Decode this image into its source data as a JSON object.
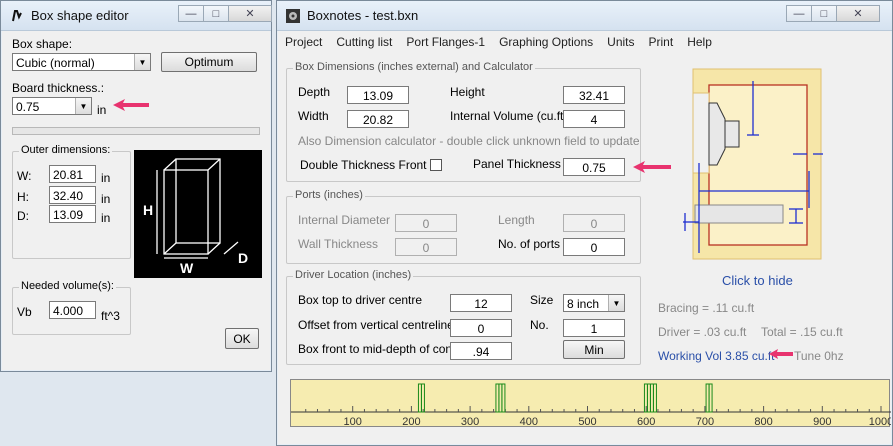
{
  "left_window": {
    "title": "Box shape editor",
    "box_shape_label": "Box shape:",
    "box_shape_value": "Cubic (normal)",
    "optimum_button": "Optimum",
    "board_thickness_label": "Board thickness.:",
    "board_thickness_value": "0.75",
    "board_thickness_unit": "in",
    "outer_dimensions_label": "Outer dimensions:",
    "outer": {
      "w_label": "W:",
      "w_value": "20.81",
      "h_label": "H:",
      "h_value": "32.40",
      "d_label": "D:",
      "d_value": "13.09",
      "unit": "in"
    },
    "diagram": {
      "h": "H",
      "w": "W",
      "d": "D"
    },
    "needed_volume_label": "Needed volume(s):",
    "vb_label": "Vb",
    "vb_value": "4.000",
    "vb_unit": "ft^3",
    "ok_button": "OK"
  },
  "right_window": {
    "title": "Boxnotes - test.bxn",
    "menu": [
      "Project",
      "Cutting list",
      "Port Flanges-1",
      "Graphing Options",
      "Units",
      "Print",
      "Help"
    ],
    "box_dimensions": {
      "group_title": "Box Dimensions (inches external) and Calculator",
      "depth_label": "Depth",
      "depth_value": "13.09",
      "height_label": "Height",
      "height_value": "32.41",
      "width_label": "Width",
      "width_value": "20.82",
      "internal_volume_label": "Internal Volume (cu.ft)",
      "internal_volume_value": "4",
      "calc_note": "Also Dimension calculator - double click unknown field to update",
      "double_thickness_label": "Double Thickness Front",
      "panel_thickness_label": "Panel Thickness",
      "panel_thickness_value": "0.75"
    },
    "ports": {
      "group_title": "Ports (inches)",
      "internal_diameter_label": "Internal Diameter",
      "internal_diameter_value": "0",
      "length_label": "Length",
      "length_value": "0",
      "wall_thickness_label": "Wall Thickness",
      "wall_thickness_value": "0",
      "num_ports_label": "No. of ports",
      "num_ports_value": "0"
    },
    "driver": {
      "group_title": "Driver Location (inches)",
      "box_top_label": "Box top to driver centre",
      "box_top_value": "12",
      "size_label": "Size",
      "size_value": "8 inch",
      "offset_label": "Offset from vertical centreline",
      "offset_value": "0",
      "no_label": "No.",
      "no_value": "1",
      "box_front_label": "Box front to mid-depth of cone",
      "box_front_value": ".94",
      "min_button": "Min"
    },
    "click_to_hide": "Click to hide",
    "bracing": "Bracing = .11 cu.ft",
    "driver_vol": "Driver =  .03 cu.ft",
    "total_vol": "Total =  .15 cu.ft",
    "working_vol": "Working Vol  3.85 cu.ft",
    "tune": "Tune  0hz",
    "scale_labels": [
      "100",
      "200",
      "300",
      "400",
      "500",
      "600",
      "700",
      "800",
      "900",
      "1000"
    ]
  },
  "colors": {
    "accent_arrow": "#e8336f",
    "diagram_blue": "#1e2fd0",
    "panel_bg": "#f6e6a8",
    "graph_bg": "#f6ecb0",
    "graph_marks": "#1a8a1a"
  }
}
